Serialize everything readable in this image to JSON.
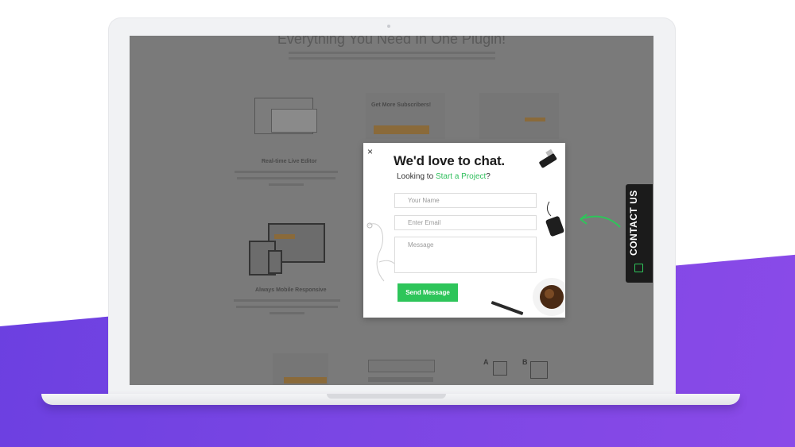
{
  "site": {
    "heading": "Everything You Need In One Plugin!",
    "subscribe_heading": "Get More Subscribers!",
    "feature_editor": "Real-time Live Editor",
    "feature_mobile": "Always Mobile Responsive",
    "orange_label": "",
    "ab_labels": [
      "A",
      "B"
    ]
  },
  "popup": {
    "close_icon": "×",
    "title": "We'd love to chat.",
    "subtitle_prefix": "Looking to ",
    "subtitle_accent": "Start a Project",
    "subtitle_suffix": "?",
    "name_placeholder": "Your Name",
    "email_placeholder": "Enter Email",
    "message_placeholder": "Message",
    "send_label": "Send Message"
  },
  "contact_tab": {
    "label": "CONTACT US",
    "icon": "message-icon"
  },
  "colors": {
    "accent_green": "#2ec55a",
    "purple": "#7b46e4",
    "overlay": "#7a7a7a"
  }
}
